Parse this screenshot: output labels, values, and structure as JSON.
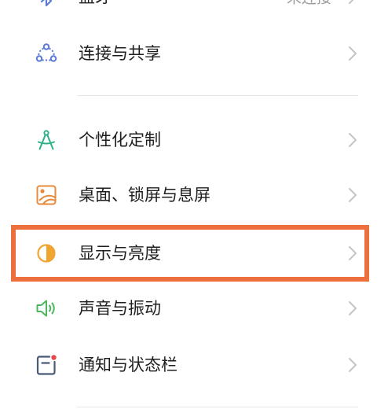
{
  "settings": {
    "items": [
      {
        "label": "蓝牙",
        "value": "未连接",
        "icon": "bluetooth-icon"
      },
      {
        "label": "连接与共享",
        "icon": "connection-sharing-icon",
        "icon_color": "#5b7bd5"
      },
      {
        "label": "个性化定制",
        "icon": "personalization-icon",
        "icon_color": "#2fb08a"
      },
      {
        "label": "桌面、锁屏与息屏",
        "icon": "wallpaper-icon",
        "icon_color": "#e88a3c"
      },
      {
        "label": "显示与亮度",
        "icon": "brightness-icon",
        "icon_color": "#f0a531"
      },
      {
        "label": "声音与振动",
        "icon": "speaker-icon",
        "icon_color": "#4cb85d"
      },
      {
        "label": "通知与状态栏",
        "icon": "notification-icon",
        "icon_color": "#4a5a78"
      }
    ]
  },
  "highlight_color": "#ee6f3e",
  "highlighted_item": "显示与亮度"
}
